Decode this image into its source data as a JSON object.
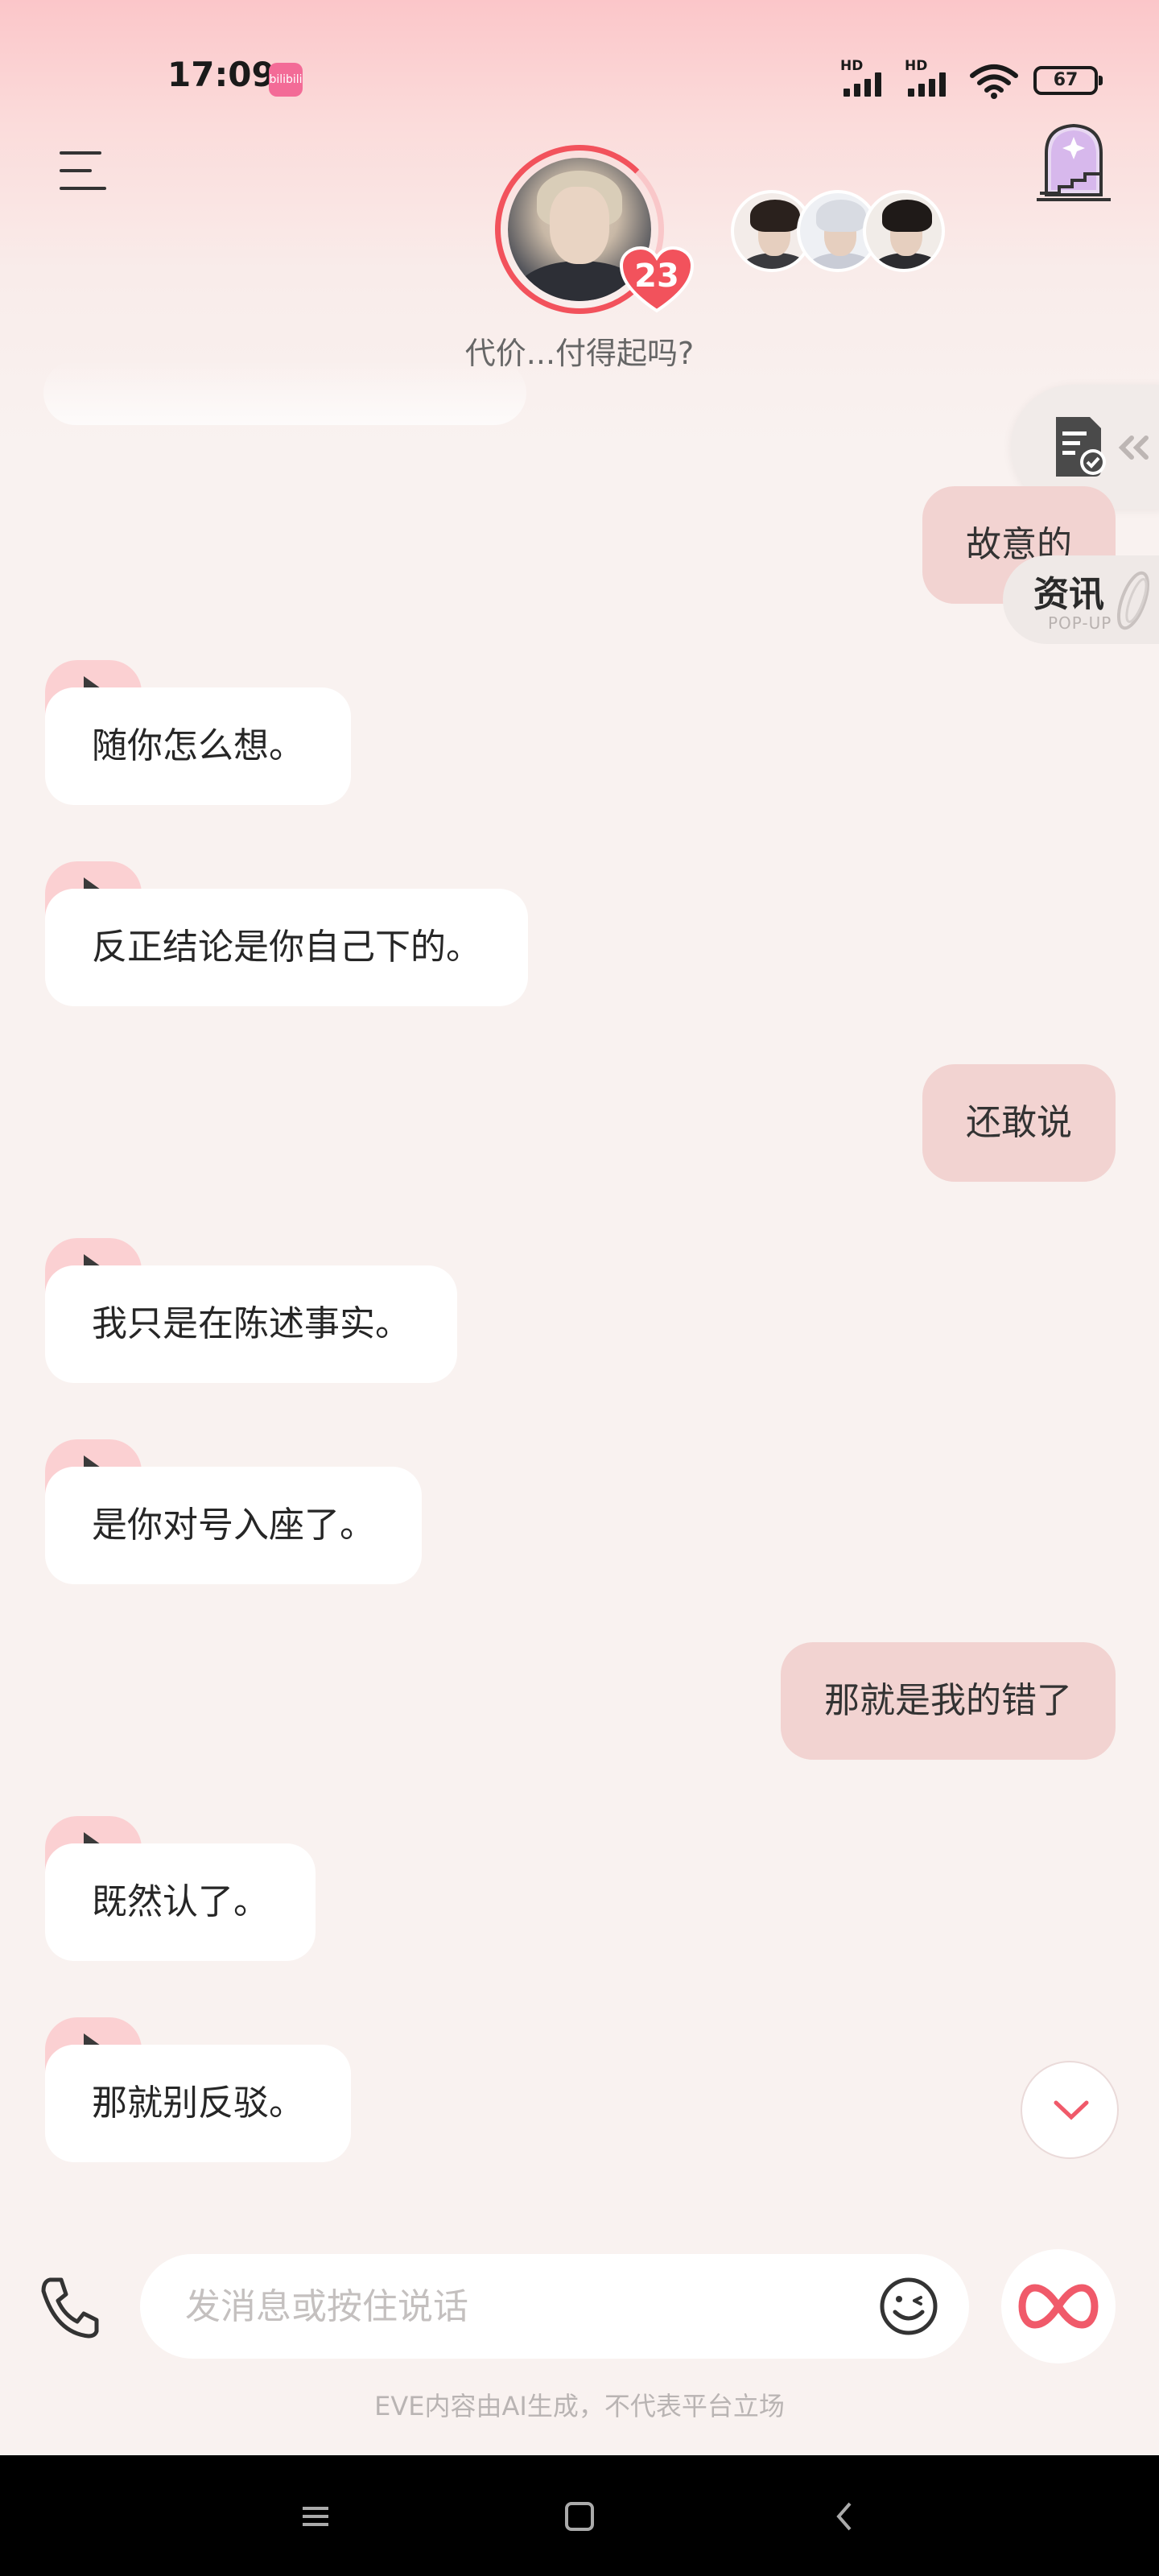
{
  "status_bar": {
    "time": "17:09",
    "app_badge": "bilibili",
    "signal1_label": "HD",
    "signal2_label": "HD",
    "battery": "67"
  },
  "header": {
    "affection_count": "23",
    "subtitle": "代价...付得起吗?"
  },
  "side_widgets": {
    "news_label": "资讯",
    "news_sub": "POP-UP"
  },
  "messages": [
    {
      "role": "user",
      "text": "故意的"
    },
    {
      "role": "ai",
      "text": "随你怎么想。"
    },
    {
      "role": "ai",
      "text": "反正结论是你自己下的。"
    },
    {
      "role": "user",
      "text": "还敢说"
    },
    {
      "role": "ai",
      "text": "我只是在陈述事实。"
    },
    {
      "role": "ai",
      "text": "是你对号入座了。"
    },
    {
      "role": "user",
      "text": "那就是我的错了"
    },
    {
      "role": "ai",
      "text": "既然认了。"
    },
    {
      "role": "ai",
      "text": "那就别反驳。"
    }
  ],
  "input": {
    "placeholder": "发消息或按住说话",
    "value": ""
  },
  "disclaimer": "EVE内容由AI生成，不代表平台立场",
  "colors": {
    "accent": "#f2525c",
    "user_bubble": "#f2d3d1",
    "ai_bubble": "#ffffff",
    "play_tab": "#fbd0d2",
    "background": "#f9f2f0"
  }
}
